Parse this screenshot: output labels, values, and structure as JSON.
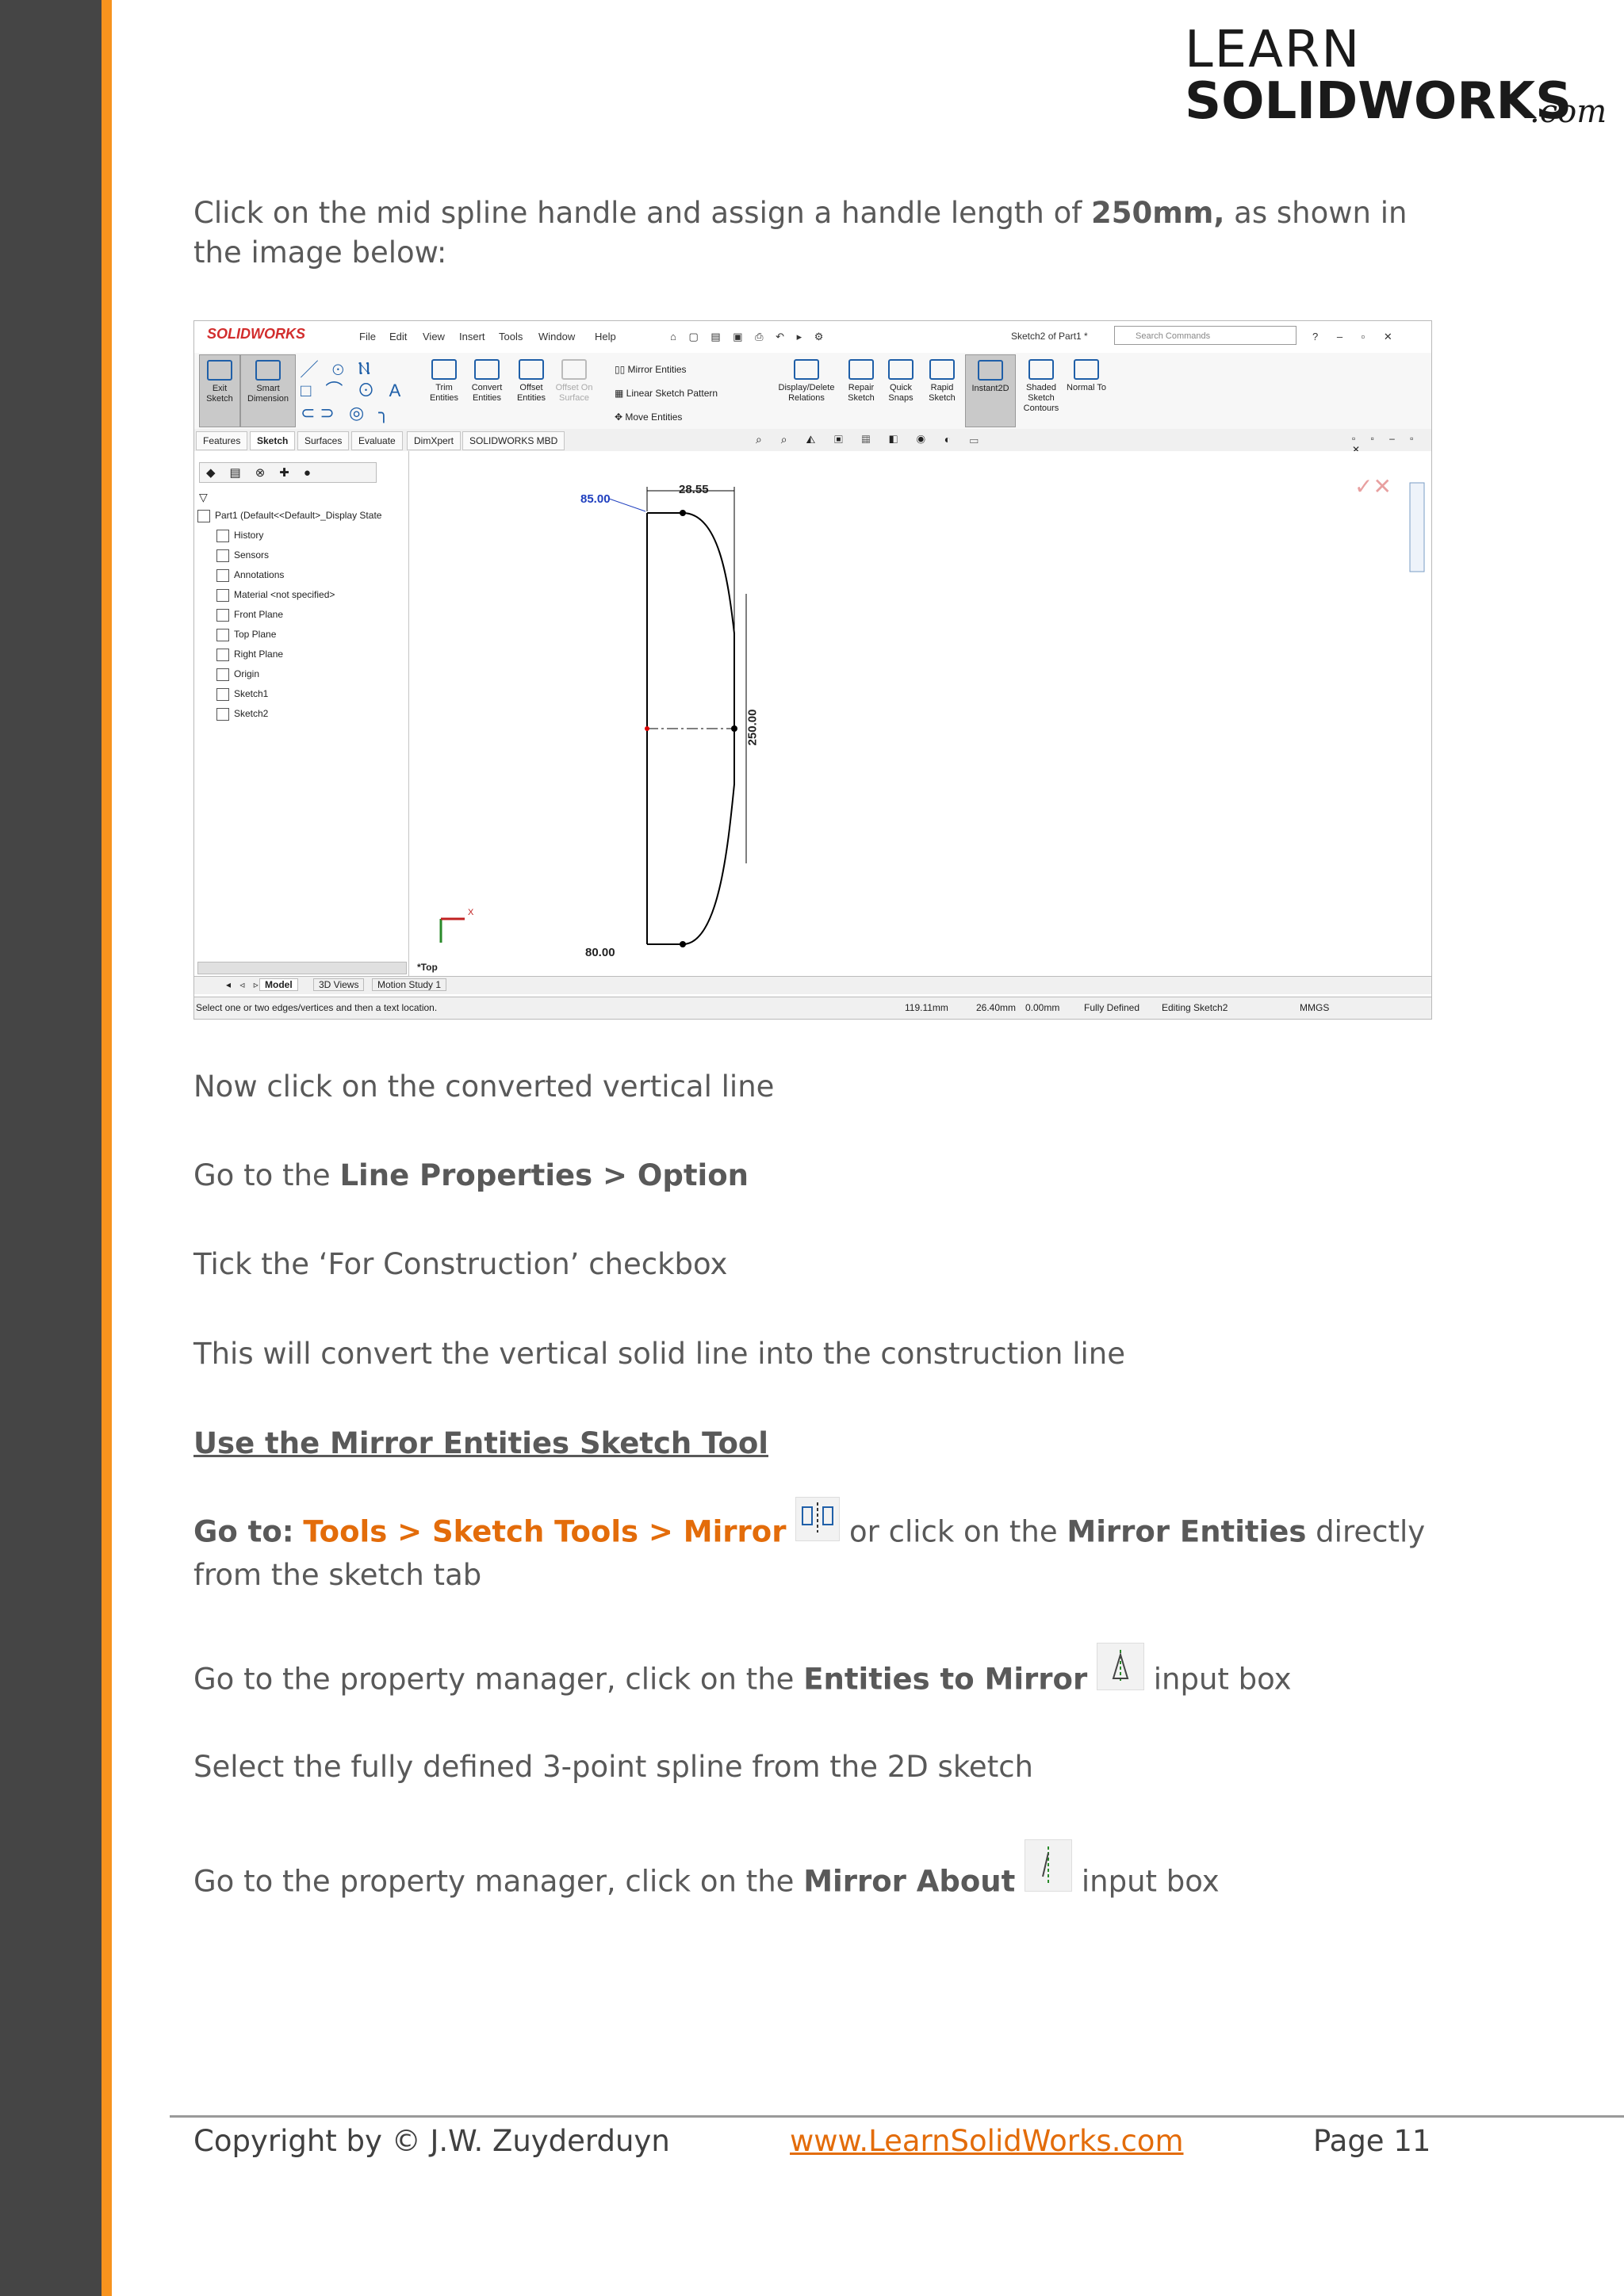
{
  "logo": {
    "line1": "LEARN",
    "line2": "SOLIDWORKS",
    "suffix": ".com"
  },
  "intro": {
    "pre": "Click on the mid spline handle and assign a handle length of ",
    "bold": "250mm,",
    "post": " as shown in the image below:"
  },
  "screenshot": {
    "app_logo": "SOLIDWORKS",
    "menu": [
      "File",
      "Edit",
      "View",
      "Insert",
      "Tools",
      "Window",
      "Help"
    ],
    "doc_title": "Sketch2 of Part1 *",
    "search_placeholder": "Search Commands",
    "ribbon": {
      "exit_sketch": "Exit Sketch",
      "smart_dimension": "Smart Dimension",
      "trim": "Trim Entities",
      "convert": "Convert Entities",
      "offset": "Offset Entities",
      "offset_surface": "Offset On Surface",
      "mirror": "Mirror Entities",
      "linear_pattern": "Linear Sketch Pattern",
      "move": "Move Entities",
      "display_delete": "Display/Delete Relations",
      "repair": "Repair Sketch",
      "quick_snaps": "Quick Snaps",
      "rapid_sketch": "Rapid Sketch",
      "instant2d": "Instant2D",
      "shaded_contours": "Shaded Sketch Contours",
      "normal_to": "Normal To"
    },
    "tabs": [
      "Features",
      "Sketch",
      "Surfaces",
      "Evaluate",
      "DimXpert",
      "SOLIDWORKS MBD"
    ],
    "tree": {
      "root": "Part1 (Default<<Default>_Display State",
      "items": [
        "History",
        "Sensors",
        "Annotations",
        "Material <not specified>",
        "Front Plane",
        "Top Plane",
        "Right Plane",
        "Origin",
        "Sketch1",
        "Sketch2"
      ]
    },
    "dims": {
      "top_width": "28.55",
      "top_left": "85.00",
      "bottom_left": "80.00",
      "vertical": "250.00"
    },
    "view_label": "*Top",
    "axis_x": "X",
    "bottom_tabs": [
      "Model",
      "3D Views",
      "Motion Study 1"
    ],
    "status": {
      "hint": "Select one or two edges/vertices and then a text location.",
      "x": "119.11mm",
      "y": "26.40mm",
      "z": "0.00mm",
      "defined": "Fully Defined",
      "editing": "Editing Sketch2",
      "units": "MMGS"
    }
  },
  "steps": {
    "s1": "Now click on the converted vertical line",
    "s2_pre": "Go to the ",
    "s2_bold": "Line Properties > Option",
    "s3": "Tick the ‘For Construction’ checkbox",
    "s4": "This will convert the vertical solid line into the construction line",
    "heading": "Use the Mirror Entities Sketch Tool",
    "s5_goto": "Go to:",
    "s5_path": "Tools > Sketch Tools > Mirror",
    "s5_mid": " or click on the ",
    "s5_bold": "Mirror Entities",
    "s5_post": " directly from the sketch tab",
    "s6_pre": "Go to the property manager, click on the ",
    "s6_bold": "Entities to Mirror",
    "s6_post": " input box",
    "s7": "Select the fully defined 3-point spline from the 2D sketch",
    "s8_pre": "Go to the property manager, click on the ",
    "s8_bold": "Mirror About",
    "s8_post": " input box"
  },
  "footer": {
    "copyright": "Copyright by © J.W. Zuyderduyn",
    "link": "www.LearnSolidWorks.com",
    "page": "Page 11"
  }
}
